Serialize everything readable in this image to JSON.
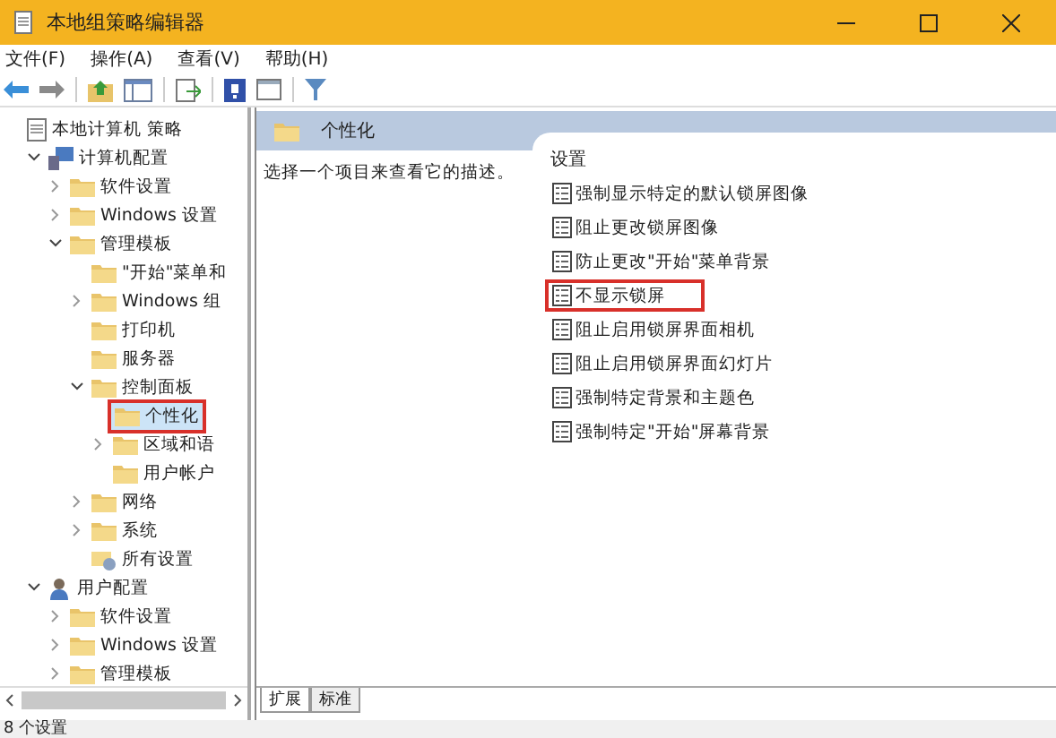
{
  "window": {
    "title": "本地组策略编辑器"
  },
  "menu": [
    "文件(F)",
    "操作(A)",
    "查看(V)",
    "帮助(H)"
  ],
  "tree": [
    {
      "label": "本地计算机 策略",
      "kind": "policy",
      "selected": false,
      "highlighted": false,
      "children": [
        {
          "label": "计算机配置",
          "kind": "computer",
          "expanded": true,
          "selected": false,
          "highlighted": false,
          "children": [
            {
              "label": "软件设置",
              "expanded": false,
              "selected": false,
              "highlighted": false
            },
            {
              "label": "Windows 设置",
              "expanded": false,
              "selected": false,
              "highlighted": false
            },
            {
              "label": "管理模板",
              "expanded": true,
              "selected": false,
              "highlighted": false,
              "children": [
                {
                  "label": "\"开始\"菜单和",
                  "selected": false,
                  "highlighted": false
                },
                {
                  "label": "Windows 组",
                  "expanded": false,
                  "selected": false,
                  "highlighted": false
                },
                {
                  "label": "打印机",
                  "selected": false,
                  "highlighted": false
                },
                {
                  "label": "服务器",
                  "selected": false,
                  "highlighted": false
                },
                {
                  "label": "控制面板",
                  "expanded": true,
                  "selected": false,
                  "highlighted": false,
                  "children": [
                    {
                      "label": "个性化",
                      "selected": true,
                      "highlighted": true
                    },
                    {
                      "label": "区域和语",
                      "expanded": false,
                      "selected": false,
                      "highlighted": false
                    },
                    {
                      "label": "用户帐户",
                      "selected": false,
                      "highlighted": false
                    }
                  ]
                },
                {
                  "label": "网络",
                  "expanded": false,
                  "selected": false,
                  "highlighted": false
                },
                {
                  "label": "系统",
                  "expanded": false,
                  "selected": false,
                  "highlighted": false
                },
                {
                  "label": "所有设置",
                  "kind": "all-settings",
                  "selected": false,
                  "highlighted": false
                }
              ]
            }
          ]
        },
        {
          "label": "用户配置",
          "kind": "user",
          "expanded": true,
          "selected": false,
          "highlighted": false,
          "children": [
            {
              "label": "软件设置",
              "expanded": false,
              "selected": false,
              "highlighted": false
            },
            {
              "label": "Windows 设置",
              "expanded": false,
              "selected": false,
              "highlighted": false
            },
            {
              "label": "管理模板",
              "expanded": false,
              "selected": false,
              "highlighted": false
            }
          ]
        }
      ]
    }
  ],
  "detail": {
    "title": "个性化",
    "description": "选择一个项目来查看它的描述。",
    "list_heading": "设置",
    "settings": [
      {
        "label": "强制显示特定的默认锁屏图像",
        "highlighted": false
      },
      {
        "label": "阻止更改锁屏图像",
        "highlighted": false
      },
      {
        "label": "防止更改\"开始\"菜单背景",
        "highlighted": false
      },
      {
        "label": "不显示锁屏",
        "highlighted": true
      },
      {
        "label": "阻止启用锁屏界面相机",
        "highlighted": false
      },
      {
        "label": "阻止启用锁屏界面幻灯片",
        "highlighted": false
      },
      {
        "label": "强制特定背景和主题色",
        "highlighted": false
      },
      {
        "label": "强制特定\"开始\"屏幕背景",
        "highlighted": false
      }
    ]
  },
  "tabs": [
    {
      "label": "扩展",
      "selected": true
    },
    {
      "label": "标准",
      "selected": false
    }
  ],
  "status_bar": "8 个设置"
}
